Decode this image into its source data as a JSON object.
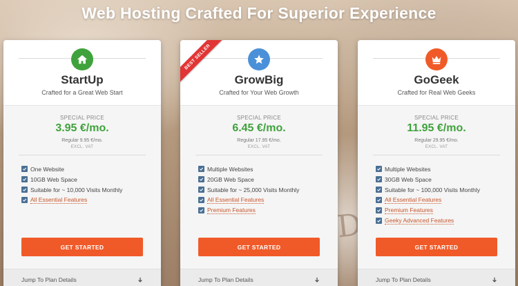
{
  "headline": "Web Hosting Crafted For Superior Experience",
  "background_text": "De",
  "plans": [
    {
      "name": "StartUp",
      "tagline": "Crafted for a Great Web Start",
      "icon": "home-icon",
      "icon_color": "#3fa23c",
      "special_label": "SPECIAL PRICE",
      "price": "3.95 €/mo.",
      "regular": "Regular 9.95 €/mo.",
      "vat": "EXCL. VAT",
      "features": [
        "One Website",
        "10GB Web Space",
        "Suitable for ~ 10,000 Visits Monthly",
        "All Essential Features"
      ],
      "cta": "GET STARTED",
      "jump": "Jump To Plan Details"
    },
    {
      "name": "GrowBig",
      "tagline": "Crafted for Your Web Growth",
      "icon": "star-icon",
      "icon_color": "#4a90d9",
      "ribbon": "BEST SELLER",
      "special_label": "SPECIAL PRICE",
      "price": "6.45 €/mo.",
      "regular": "Regular 17.95 €/mo.",
      "vat": "EXCL. VAT",
      "features": [
        "Multiple Websites",
        "20GB Web Space",
        "Suitable for ~ 25,000 Visits Monthly",
        "All Essential Features",
        "Premium Features"
      ],
      "cta": "GET STARTED",
      "jump": "Jump To Plan Details"
    },
    {
      "name": "GoGeek",
      "tagline": "Crafted for Real Web Geeks",
      "icon": "crown-icon",
      "icon_color": "#f05a28",
      "special_label": "SPECIAL PRICE",
      "price": "11.95 €/mo.",
      "regular": "Regular 29.95 €/mo.",
      "vat": "EXCL. VAT",
      "features": [
        "Multiple Websites",
        "30GB Web Space",
        "Suitable for ~ 100,000 Visits Monthly",
        "All Essential Features",
        "Premium Features",
        "Geeky Advanced Features"
      ],
      "cta": "GET STARTED",
      "jump": "Jump To Plan Details"
    }
  ],
  "colors": {
    "accent": "#f05a28",
    "price_green": "#3fa23c",
    "checkbox": "#4a6f94",
    "ribbon": "#e23535",
    "link": "#c8552a"
  }
}
